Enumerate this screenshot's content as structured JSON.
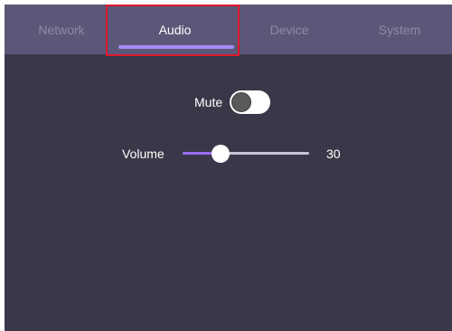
{
  "tabs": [
    {
      "label": "Network",
      "active": false
    },
    {
      "label": "Audio",
      "active": true
    },
    {
      "label": "Device",
      "active": false
    },
    {
      "label": "System",
      "active": false
    }
  ],
  "audio": {
    "mute_label": "Mute",
    "mute_on": false,
    "volume_label": "Volume",
    "volume_value": "30",
    "volume_level": 0.3
  },
  "colors": {
    "background": "#3a3848",
    "tabbar": "#5c5778",
    "accent": "#a68af5",
    "highlight": "#e0182b"
  }
}
